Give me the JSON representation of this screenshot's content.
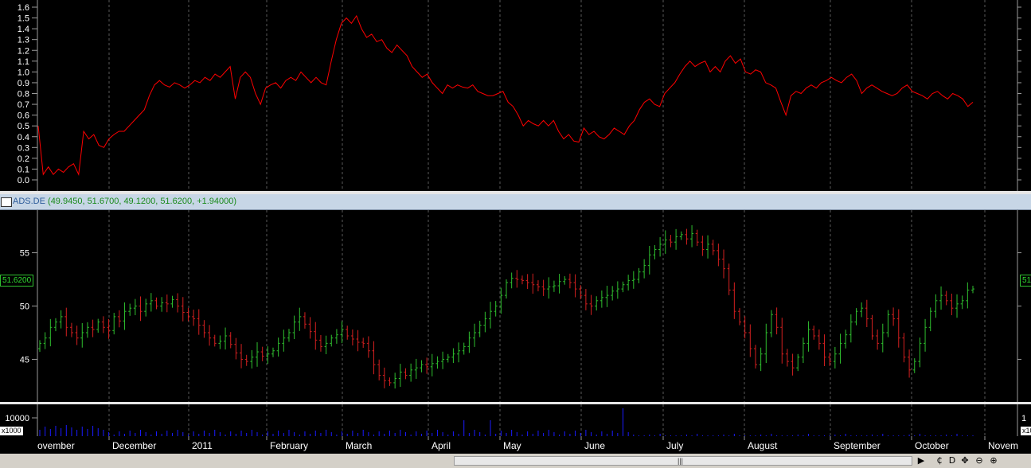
{
  "indicator": {
    "color": "#ff0000",
    "ticks": [
      "1.6",
      "1.5",
      "1.4",
      "1.3",
      "1.2",
      "1.1",
      "1.0",
      "0.9",
      "0.8",
      "0.7",
      "0.6",
      "0.5",
      "0.4",
      "0.3",
      "0.2",
      "0.1",
      "0.0"
    ],
    "ylim": [
      0.0,
      1.6
    ],
    "values": [
      0.5,
      0.05,
      0.12,
      0.05,
      0.1,
      0.07,
      0.12,
      0.15,
      0.05,
      0.45,
      0.38,
      0.42,
      0.32,
      0.3,
      0.38,
      0.42,
      0.45,
      0.45,
      0.5,
      0.55,
      0.6,
      0.65,
      0.78,
      0.88,
      0.92,
      0.88,
      0.86,
      0.9,
      0.88,
      0.85,
      0.88,
      0.92,
      0.9,
      0.95,
      0.92,
      0.98,
      0.95,
      1.0,
      1.05,
      0.75,
      0.95,
      1.0,
      0.95,
      0.8,
      0.7,
      0.85,
      0.88,
      0.9,
      0.85,
      0.92,
      0.95,
      0.92,
      1.0,
      0.95,
      0.9,
      0.95,
      0.9,
      0.88,
      1.1,
      1.3,
      1.45,
      1.5,
      1.45,
      1.52,
      1.4,
      1.32,
      1.35,
      1.28,
      1.3,
      1.22,
      1.18,
      1.25,
      1.2,
      1.15,
      1.05,
      1.0,
      0.95,
      0.98,
      0.9,
      0.85,
      0.8,
      0.88,
      0.85,
      0.88,
      0.86,
      0.85,
      0.88,
      0.82,
      0.8,
      0.78,
      0.78,
      0.8,
      0.82,
      0.72,
      0.68,
      0.6,
      0.5,
      0.55,
      0.52,
      0.5,
      0.55,
      0.5,
      0.55,
      0.45,
      0.38,
      0.42,
      0.36,
      0.35,
      0.48,
      0.42,
      0.45,
      0.4,
      0.38,
      0.42,
      0.48,
      0.45,
      0.42,
      0.5,
      0.55,
      0.65,
      0.72,
      0.75,
      0.7,
      0.68,
      0.8,
      0.85,
      0.9,
      0.98,
      1.05,
      1.1,
      1.05,
      1.08,
      1.1,
      1.0,
      1.05,
      1.0,
      1.1,
      1.15,
      1.08,
      1.12,
      1.0,
      0.98,
      1.02,
      1.0,
      0.9,
      0.88,
      0.85,
      0.72,
      0.6,
      0.78,
      0.82,
      0.8,
      0.85,
      0.88,
      0.85,
      0.9,
      0.92,
      0.95,
      0.92,
      0.9,
      0.95,
      0.98,
      0.92,
      0.8,
      0.85,
      0.88,
      0.85,
      0.82,
      0.8,
      0.78,
      0.8,
      0.85,
      0.88,
      0.82,
      0.8,
      0.78,
      0.75,
      0.8,
      0.82,
      0.78,
      0.75,
      0.8,
      0.78,
      0.75,
      0.68,
      0.72
    ]
  },
  "title_bar": {
    "symbol": "ADS.DE",
    "values": "(49.9450, 51.6700, 49.1200, 51.6200, +1.94000)"
  },
  "price": {
    "ticks": [
      "55",
      "50",
      "45"
    ],
    "last_value": "51.6200",
    "last_value_right": "51",
    "up_color": "#2fbf2f",
    "down_color": "#d42020",
    "ylim": [
      41.0,
      59.0
    ],
    "closes": [
      46.5,
      47,
      48,
      48.5,
      49,
      48,
      47.5,
      47,
      47.5,
      48,
      47.8,
      48.5,
      48,
      47.7,
      49,
      48.6,
      49.5,
      49.8,
      50,
      49.5,
      50.2,
      50.5,
      50,
      50.3,
      50.2,
      50.6,
      50,
      49.4,
      49,
      48.8,
      48.2,
      47.5,
      47,
      46.5,
      46.7,
      47.2,
      46.4,
      45.6,
      45,
      44.8,
      45.2,
      45.7,
      45.3,
      45.5,
      45.8,
      46.5,
      47,
      47.5,
      48.5,
      49,
      48.3,
      47.6,
      46.8,
      46.2,
      46.5,
      47,
      47.3,
      47.8,
      47.2,
      46.9,
      46.6,
      46.5,
      45.8,
      44.5,
      43.5,
      43,
      42.8,
      43.2,
      43.8,
      43.5,
      44,
      44.2,
      44.5,
      44.3,
      44.6,
      44.8,
      45,
      45.2,
      45.5,
      45.8,
      46.2,
      47,
      47.5,
      48.2,
      48.8,
      49.5,
      50,
      51,
      52.2,
      52.6,
      52.5,
      52.4,
      52.2,
      52,
      51.8,
      51.6,
      51.8,
      51.9,
      52.3,
      52.5,
      52.2,
      51.6,
      51,
      50.2,
      50,
      50.5,
      50.8,
      51,
      51.4,
      51.6,
      52,
      52.4,
      52.5,
      53.2,
      53.8,
      54.8,
      55.3,
      55.8,
      56.2,
      56,
      56.5,
      56.7,
      56.3,
      56.8,
      56,
      55.3,
      55.8,
      55.2,
      54.4,
      53.5,
      51.5,
      49.5,
      48.5,
      47.5,
      46,
      44.5,
      45.5,
      47.5,
      49.2,
      48,
      45.5,
      44.8,
      44.2,
      45.2,
      46.5,
      47.8,
      47.2,
      46.5,
      45.2,
      44.8,
      45.5,
      46.5,
      47.3,
      48.5,
      49.5,
      49.8,
      48.8,
      47.2,
      46.5,
      47.5,
      49.2,
      48.8,
      47,
      45.2,
      44,
      44.8,
      46.5,
      48,
      49.5,
      50.5,
      51,
      50.5,
      49.8,
      50.2,
      50.5,
      51.5,
      51.6
    ]
  },
  "volume": {
    "tick": "10000",
    "tick_right": "1",
    "multiplier": "x1000",
    "multiplier_right": "x10",
    "color": "#1a1aff"
  },
  "date_axis": {
    "labels": [
      "ovember",
      "December",
      "2011",
      "February",
      "March",
      "April",
      "May",
      "June",
      "July",
      "August",
      "September",
      "October",
      "Novem"
    ]
  },
  "toolbar": {
    "scroll_grip": "|||",
    "icons": [
      "▶",
      "₵",
      "D",
      "✥",
      "⊖",
      "⊕"
    ]
  }
}
